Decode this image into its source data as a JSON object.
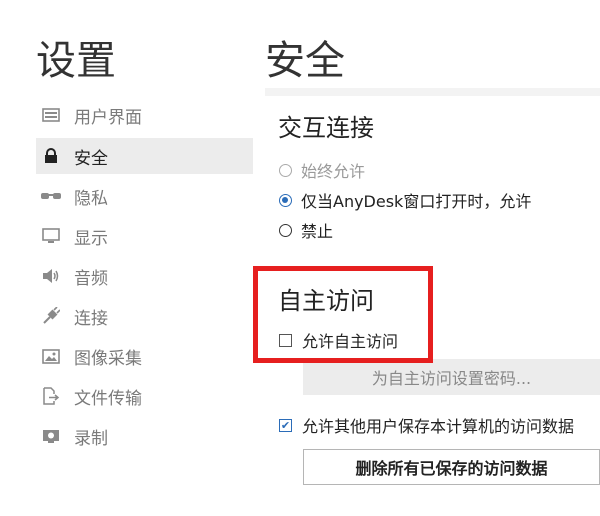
{
  "sidebar": {
    "title": "设置",
    "items": [
      {
        "label": "用户界面",
        "icon": "monitor-window-icon"
      },
      {
        "label": "安全",
        "icon": "lock-icon"
      },
      {
        "label": "隐私",
        "icon": "glasses-icon"
      },
      {
        "label": "显示",
        "icon": "display-icon"
      },
      {
        "label": "音频",
        "icon": "speaker-icon"
      },
      {
        "label": "连接",
        "icon": "plug-icon"
      },
      {
        "label": "图像采集",
        "icon": "image-icon"
      },
      {
        "label": "文件传输",
        "icon": "file-transfer-icon"
      },
      {
        "label": "录制",
        "icon": "record-icon"
      }
    ],
    "active_index": 1
  },
  "main": {
    "title": "安全",
    "interactive": {
      "heading": "交互连接",
      "options": [
        {
          "label": "始终允许",
          "checked": false,
          "disabled": true
        },
        {
          "label": "仅当AnyDesk窗口打开时，允许",
          "checked": true,
          "disabled": false
        },
        {
          "label": "禁止",
          "checked": false,
          "disabled": false
        }
      ]
    },
    "unattended": {
      "heading": "自主访问",
      "enable_label": "允许自主访问",
      "enable_checked": false,
      "set_password_button": "为自主访问设置密码...",
      "allow_save_label": "允许其他用户保存本计算机的访问数据",
      "allow_save_checked": true,
      "delete_button": "删除所有已保存的访问数据"
    }
  },
  "colors": {
    "highlight": "#e61f1f",
    "accent": "#2b6cb8"
  }
}
